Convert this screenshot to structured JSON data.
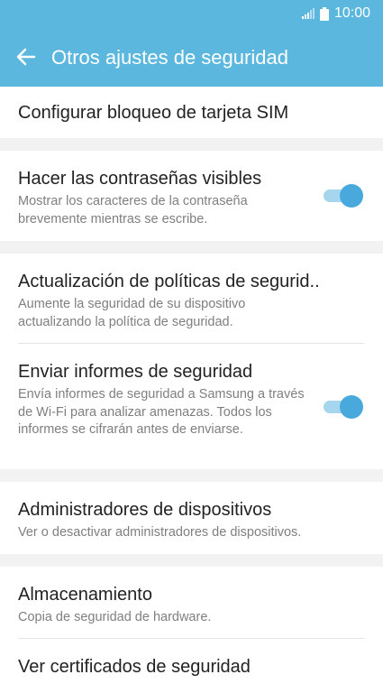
{
  "status_bar": {
    "time": "10:00",
    "signal_icon": "signal-bars-icon",
    "battery_icon": "battery-icon"
  },
  "app_bar": {
    "title": "Otros ajustes de seguridad",
    "back_icon": "arrow-left-icon"
  },
  "colors": {
    "app_bar": "#5bb7dd",
    "toggle_thumb": "#4aa9dc",
    "toggle_track": "#a6d6ee",
    "background": "#f2f2f2"
  },
  "items": [
    {
      "title": "Configurar bloqueo de tarjeta SIM"
    },
    {
      "title": "Hacer las contraseñas visibles",
      "subtitle": "Mostrar los caracteres de la contraseña brevemente mientras se escribe.",
      "toggle_on": true
    },
    {
      "title": "Actualización de políticas de segurid..",
      "subtitle": "Aumente la seguridad de su dispositivo actualizando la política de seguridad."
    },
    {
      "title": "Enviar informes de seguridad",
      "subtitle": "Envía informes de seguridad a Samsung a través de Wi-Fi para analizar amenazas. Todos los informes se cifrarán antes de enviarse.",
      "toggle_on": true
    },
    {
      "title": "Administradores de dispositivos",
      "subtitle": "Ver o desactivar administradores de dispositivos."
    },
    {
      "title": "Almacenamiento",
      "subtitle": "Copia de seguridad de hardware."
    },
    {
      "title": "Ver certificados de seguridad"
    }
  ]
}
